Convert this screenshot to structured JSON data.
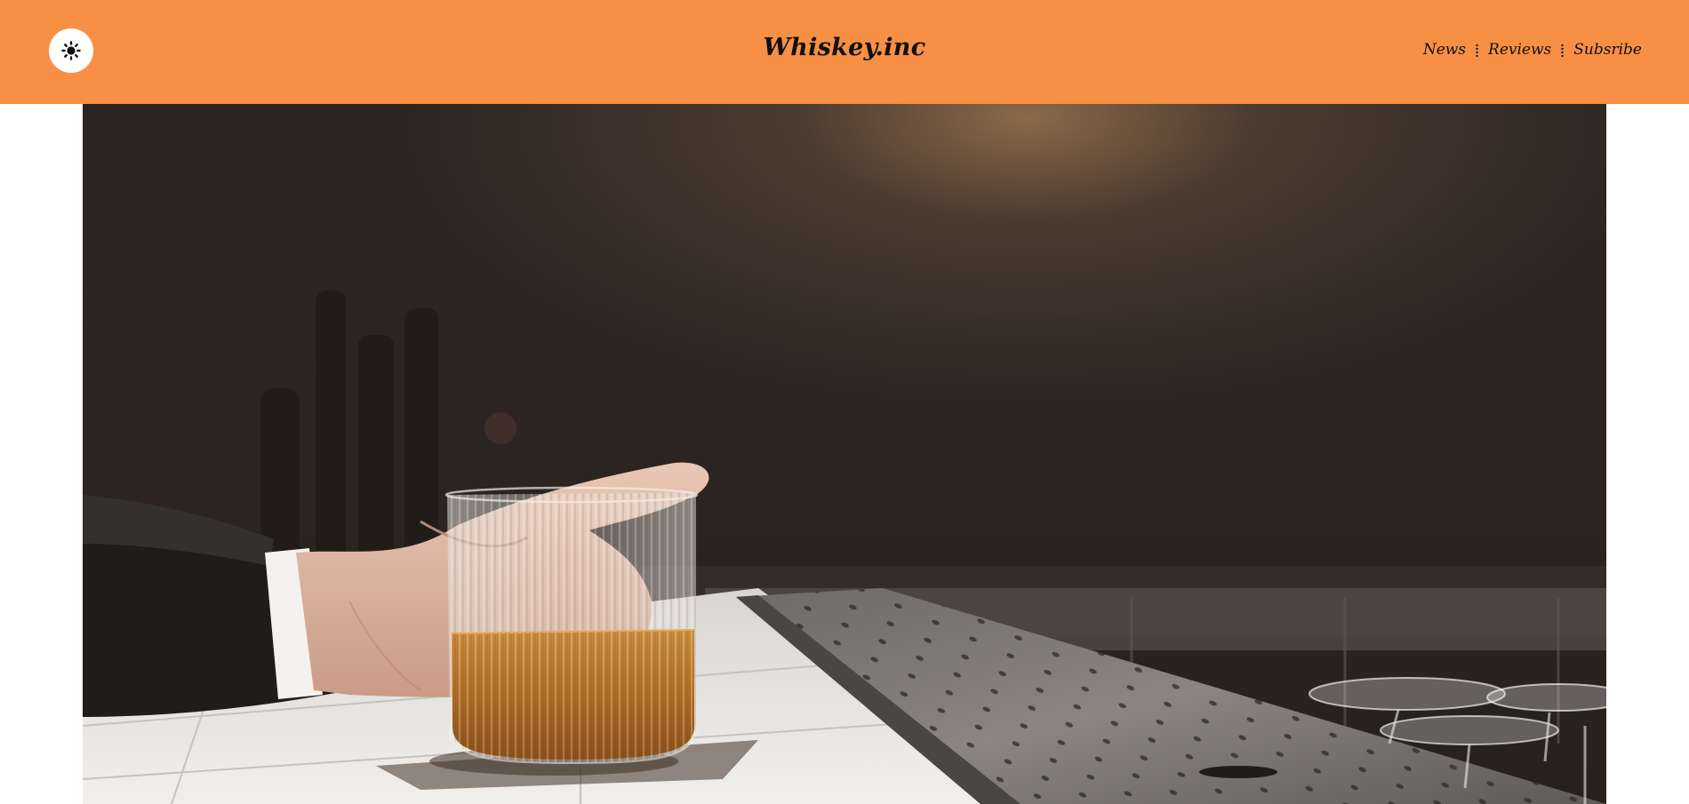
{
  "header": {
    "background_color": "#f78f45",
    "brand": "Whiskey.inc",
    "theme_toggle_icon": "sun-icon",
    "nav": [
      {
        "label": "News"
      },
      {
        "label": "Reviews"
      },
      {
        "label": "Subsribe"
      }
    ]
  },
  "hero": {
    "image": "hand-holding-whiskey-glass-at-bar-photo"
  }
}
